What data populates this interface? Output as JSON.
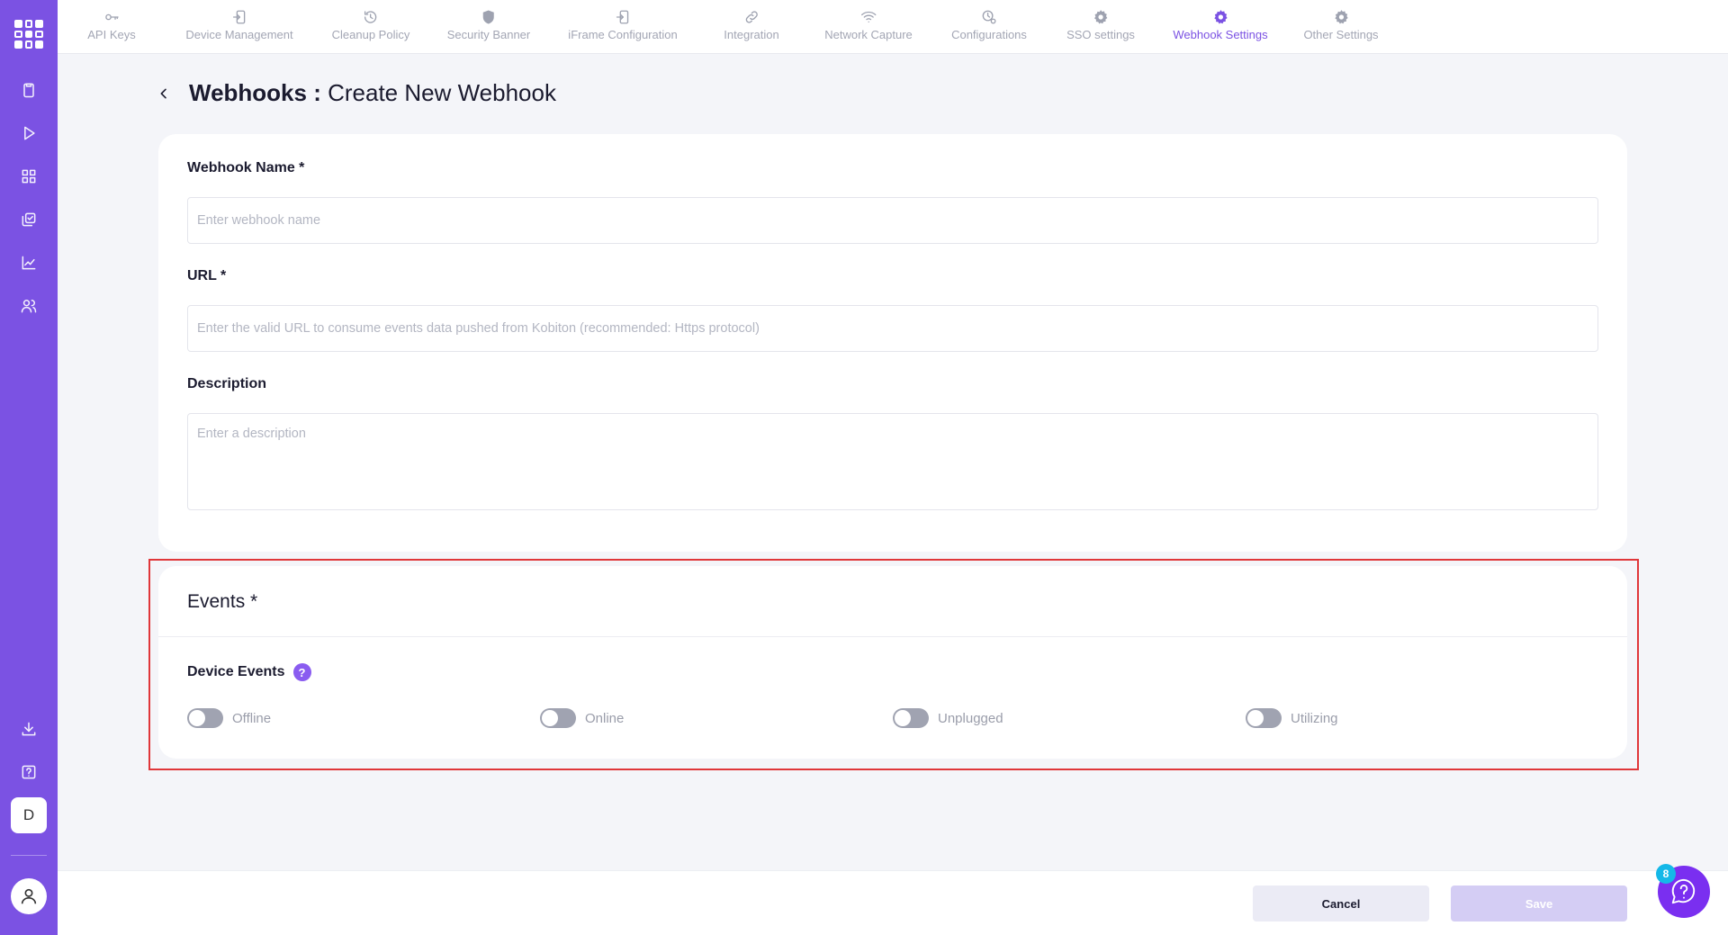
{
  "brand": {
    "accent": "#7b52e3",
    "sidebar_bg": "#7b52e3"
  },
  "sidebar": {
    "icons": [
      "clipboard-icon",
      "play-icon",
      "grid-icon",
      "copy-check-icon",
      "trend-chart-icon",
      "users-icon",
      "download-icon",
      "help-square-icon"
    ],
    "workspace_initial": "D"
  },
  "tabs": [
    {
      "label": "API Keys",
      "icon": "key-icon",
      "active": false
    },
    {
      "label": "Device Management",
      "icon": "device-login-icon",
      "active": false
    },
    {
      "label": "Cleanup Policy",
      "icon": "history-icon",
      "active": false
    },
    {
      "label": "Security Banner",
      "icon": "shield-icon",
      "active": false
    },
    {
      "label": "iFrame Configuration",
      "icon": "device-login-icon",
      "active": false
    },
    {
      "label": "Integration",
      "icon": "link-icon",
      "active": false
    },
    {
      "label": "Network Capture",
      "icon": "wifi-icon",
      "active": false
    },
    {
      "label": "Configurations",
      "icon": "clock-gear-icon",
      "active": false
    },
    {
      "label": "SSO settings",
      "icon": "gear-icon",
      "active": false
    },
    {
      "label": "Webhook Settings",
      "icon": "gear-icon",
      "active": true
    },
    {
      "label": "Other Settings",
      "icon": "gear-icon",
      "active": false
    }
  ],
  "header": {
    "title_bold": "Webhooks :",
    "title_rest": "Create New Webhook"
  },
  "form": {
    "name_label": "Webhook Name *",
    "name_placeholder": "Enter webhook name",
    "name_value": "",
    "url_label": "URL *",
    "url_placeholder": "Enter the valid URL to consume events data pushed from Kobiton (recommended: Https protocol)",
    "url_value": "",
    "description_label": "Description",
    "description_placeholder": "Enter a description",
    "description_value": ""
  },
  "events": {
    "title": "Events *",
    "device_events_title": "Device Events",
    "help_glyph": "?",
    "toggles": [
      {
        "label": "Offline",
        "on": false
      },
      {
        "label": "Online",
        "on": false
      },
      {
        "label": "Unplugged",
        "on": false
      },
      {
        "label": "Utilizing",
        "on": false
      }
    ]
  },
  "footer": {
    "cancel_label": "Cancel",
    "save_label": "Save",
    "save_disabled": true
  },
  "help_widget": {
    "badge_count": "8"
  }
}
